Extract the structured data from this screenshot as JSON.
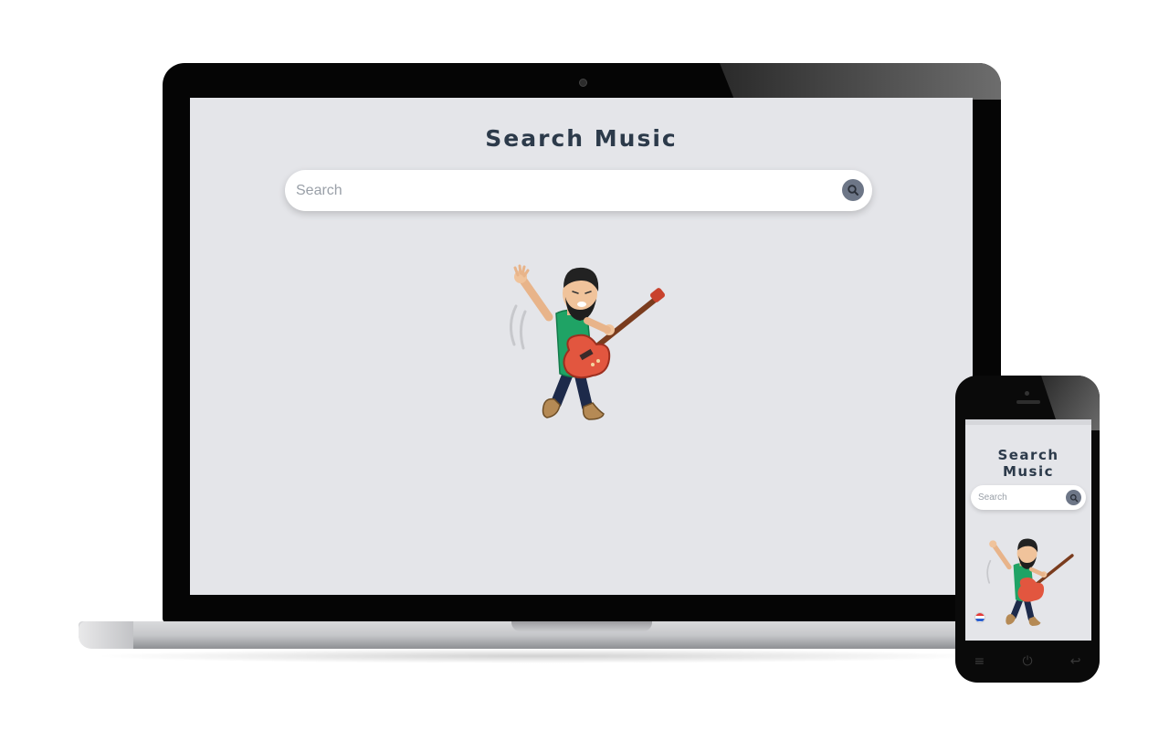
{
  "app": {
    "title": "Search Music",
    "search": {
      "placeholder": "Search",
      "value": ""
    }
  },
  "mobile": {
    "title_line1": "Search",
    "title_line2": "Music",
    "search": {
      "placeholder": "Search",
      "value": ""
    },
    "nav": {
      "menu_glyph": "≡",
      "home_glyph": "⏻",
      "back_glyph": "↩"
    }
  },
  "icons": {
    "search_button": "magnifier-icon",
    "illustration": "guitarist-avatar-icon"
  },
  "colors": {
    "screen_bg": "#e4e5e9",
    "title": "#2c3a4a",
    "search_button": "#6d7687",
    "shirt": "#1fa365",
    "guitar": "#e2563f"
  }
}
